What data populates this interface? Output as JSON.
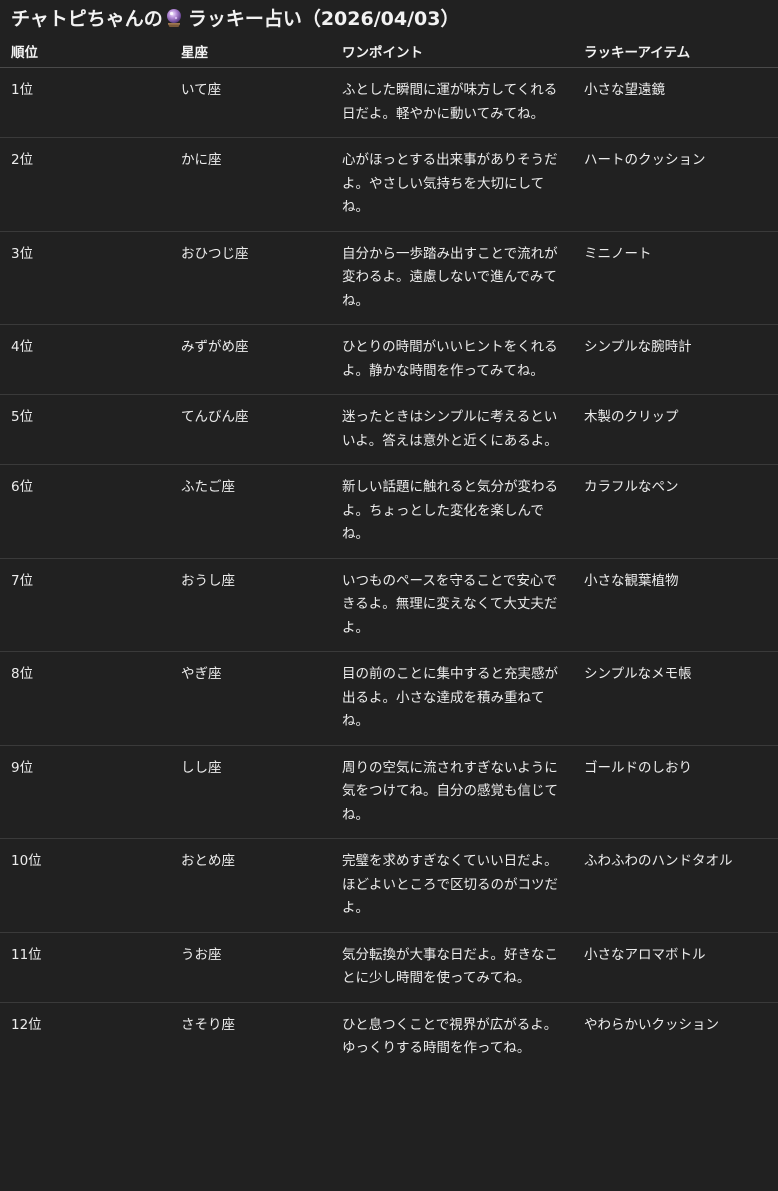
{
  "title": {
    "prefix": "チャトピちゃんの",
    "suffix": "ラッキー占い（2026/04/03）",
    "icon": "crystal-ball-icon"
  },
  "table": {
    "headers": {
      "rank": "順位",
      "sign": "星座",
      "tip": "ワンポイント",
      "item": "ラッキーアイテム"
    },
    "rows": [
      {
        "rank": "1位",
        "sign": "いて座",
        "tip": "ふとした瞬間に運が味方してくれる日だよ。軽やかに動いてみてね。",
        "item": "小さな望遠鏡"
      },
      {
        "rank": "2位",
        "sign": "かに座",
        "tip": "心がほっとする出来事がありそうだよ。やさしい気持ちを大切にしてね。",
        "item": "ハートのクッション"
      },
      {
        "rank": "3位",
        "sign": "おひつじ座",
        "tip": "自分から一歩踏み出すことで流れが変わるよ。遠慮しないで進んでみてね。",
        "item": "ミニノート"
      },
      {
        "rank": "4位",
        "sign": "みずがめ座",
        "tip": "ひとりの時間がいいヒントをくれるよ。静かな時間を作ってみてね。",
        "item": "シンプルな腕時計"
      },
      {
        "rank": "5位",
        "sign": "てんびん座",
        "tip": "迷ったときはシンプルに考えるといいよ。答えは意外と近くにあるよ。",
        "item": "木製のクリップ"
      },
      {
        "rank": "6位",
        "sign": "ふたご座",
        "tip": "新しい話題に触れると気分が変わるよ。ちょっとした変化を楽しんでね。",
        "item": "カラフルなペン"
      },
      {
        "rank": "7位",
        "sign": "おうし座",
        "tip": "いつものペースを守ることで安心できるよ。無理に変えなくて大丈夫だよ。",
        "item": "小さな観葉植物"
      },
      {
        "rank": "8位",
        "sign": "やぎ座",
        "tip": "目の前のことに集中すると充実感が出るよ。小さな達成を積み重ねてね。",
        "item": "シンプルなメモ帳"
      },
      {
        "rank": "9位",
        "sign": "しし座",
        "tip": "周りの空気に流されすぎないように気をつけてね。自分の感覚も信じてね。",
        "item": "ゴールドのしおり"
      },
      {
        "rank": "10位",
        "sign": "おとめ座",
        "tip": "完璧を求めすぎなくていい日だよ。ほどよいところで区切るのがコツだよ。",
        "item": "ふわふわのハンドタオル"
      },
      {
        "rank": "11位",
        "sign": "うお座",
        "tip": "気分転換が大事な日だよ。好きなことに少し時間を使ってみてね。",
        "item": "小さなアロマボトル"
      },
      {
        "rank": "12位",
        "sign": "さそり座",
        "tip": "ひと息つくことで視界が広がるよ。ゆっくりする時間を作ってね。",
        "item": "やわらかいクッション"
      }
    ]
  }
}
